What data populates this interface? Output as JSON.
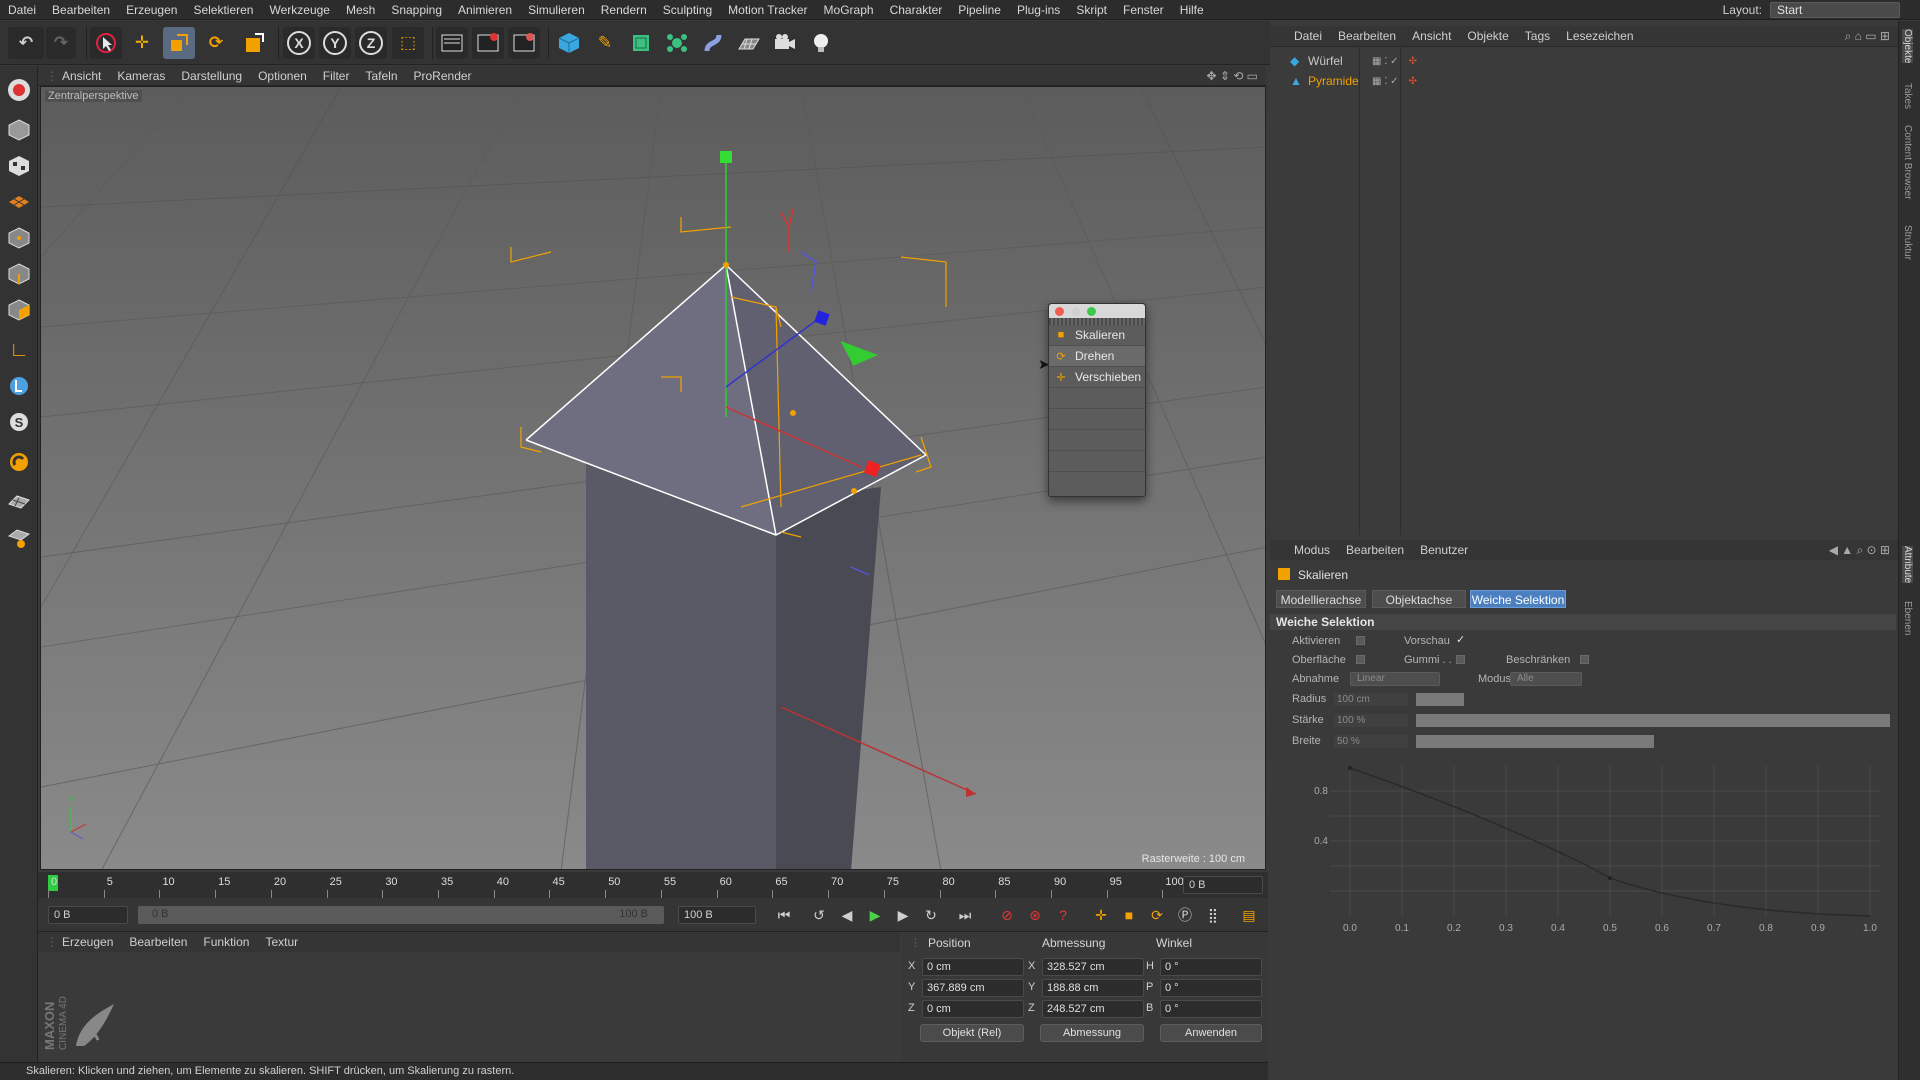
{
  "menubar": {
    "items": [
      "Datei",
      "Bearbeiten",
      "Erzeugen",
      "Selektieren",
      "Werkzeuge",
      "Mesh",
      "Snapping",
      "Animieren",
      "Simulieren",
      "Rendern",
      "Sculpting",
      "Motion Tracker",
      "MoGraph",
      "Charakter",
      "Pipeline",
      "Plug-ins",
      "Skript",
      "Fenster",
      "Hilfe"
    ],
    "layout_label": "Layout:",
    "layout_value": "Start"
  },
  "toolbar": {
    "axis_x": "X",
    "axis_y": "Y",
    "axis_z": "Z"
  },
  "viewport": {
    "menu": [
      "Ansicht",
      "Kameras",
      "Darstellung",
      "Optionen",
      "Filter",
      "Tafeln",
      "ProRender"
    ],
    "camera_label": "Zentralperspektive",
    "grid_label": "Rasterweite : 100 cm"
  },
  "popup": {
    "items": [
      {
        "label": "Skalieren",
        "icon": "scale-icon"
      },
      {
        "label": "Drehen",
        "icon": "rotate-icon"
      },
      {
        "label": "Verschieben",
        "icon": "move-icon"
      }
    ]
  },
  "timeline": {
    "ticks": [
      "0",
      "5",
      "10",
      "15",
      "20",
      "25",
      "30",
      "35",
      "40",
      "45",
      "50",
      "55",
      "60",
      "65",
      "70",
      "75",
      "80",
      "85",
      "90",
      "95",
      "100"
    ],
    "current_frame_field": "0 B",
    "start_field": "0 B",
    "range_start": "0 B",
    "range_end": "100 B",
    "end_field": "100 B"
  },
  "material_menu": [
    "Erzeugen",
    "Bearbeiten",
    "Funktion",
    "Textur"
  ],
  "coords": {
    "headers": {
      "position": "Position",
      "size": "Abmessung",
      "rotation": "Winkel"
    },
    "rows": [
      {
        "axis": "X",
        "pos": "0 cm",
        "size_axis": "X",
        "size": "328.527 cm",
        "rot_axis": "H",
        "rot": "0 °"
      },
      {
        "axis": "Y",
        "pos": "367.889 cm",
        "size_axis": "Y",
        "size": "188.88 cm",
        "rot_axis": "P",
        "rot": "0 °"
      },
      {
        "axis": "Z",
        "pos": "0 cm",
        "size_axis": "Z",
        "size": "248.527 cm",
        "rot_axis": "B",
        "rot": "0 °"
      }
    ],
    "mode_dropdown": "Objekt (Rel)",
    "size_dropdown": "Abmessung",
    "apply_button": "Anwenden"
  },
  "statusbar": {
    "text": "Skalieren: Klicken und ziehen, um Elemente zu skalieren. SHIFT drücken, um Skalierung zu rastern."
  },
  "objects": {
    "menu": [
      "Datei",
      "Bearbeiten",
      "Ansicht",
      "Objekte",
      "Tags",
      "Lesezeichen"
    ],
    "items": [
      {
        "name": "Würfel",
        "color": "#c8c8c8"
      },
      {
        "name": "Pyramide",
        "color": "#f2a100"
      }
    ]
  },
  "attributes": {
    "menu": [
      "Modus",
      "Bearbeiten",
      "Benutzer"
    ],
    "tool_title": "Skalieren",
    "tabs": [
      "Modellierachse",
      "Objektachse",
      "Weiche Selektion"
    ],
    "active_tab": 2,
    "section_title": "Weiche Selektion",
    "labels": {
      "aktivieren": "Aktivieren",
      "vorschau": "Vorschau",
      "oberflaeche": "Oberfläche",
      "gummi": "Gummi . .",
      "beschraenken": "Beschränken",
      "abnahme": "Abnahme",
      "abnahme_value": "Linear",
      "modus": "Modus",
      "modus_value": "Alle",
      "radius": "Radius",
      "radius_value": "100 cm",
      "staerke": "Stärke",
      "staerke_value": "100 %",
      "breite": "Breite",
      "breite_value": "50 %"
    },
    "graph": {
      "y_ticks": [
        "0.8",
        "0.4"
      ],
      "x_ticks": [
        "0.0",
        "0.1",
        "0.2",
        "0.3",
        "0.4",
        "0.5",
        "0.6",
        "0.7",
        "0.8",
        "0.9",
        "1.0"
      ]
    }
  },
  "side_tabs": [
    "Objekte",
    "Takes",
    "Content Browser",
    "Struktur",
    "Attribute",
    "Ebenen"
  ],
  "logo": {
    "text1": "MAXON",
    "text2": "CINEMA 4D"
  }
}
